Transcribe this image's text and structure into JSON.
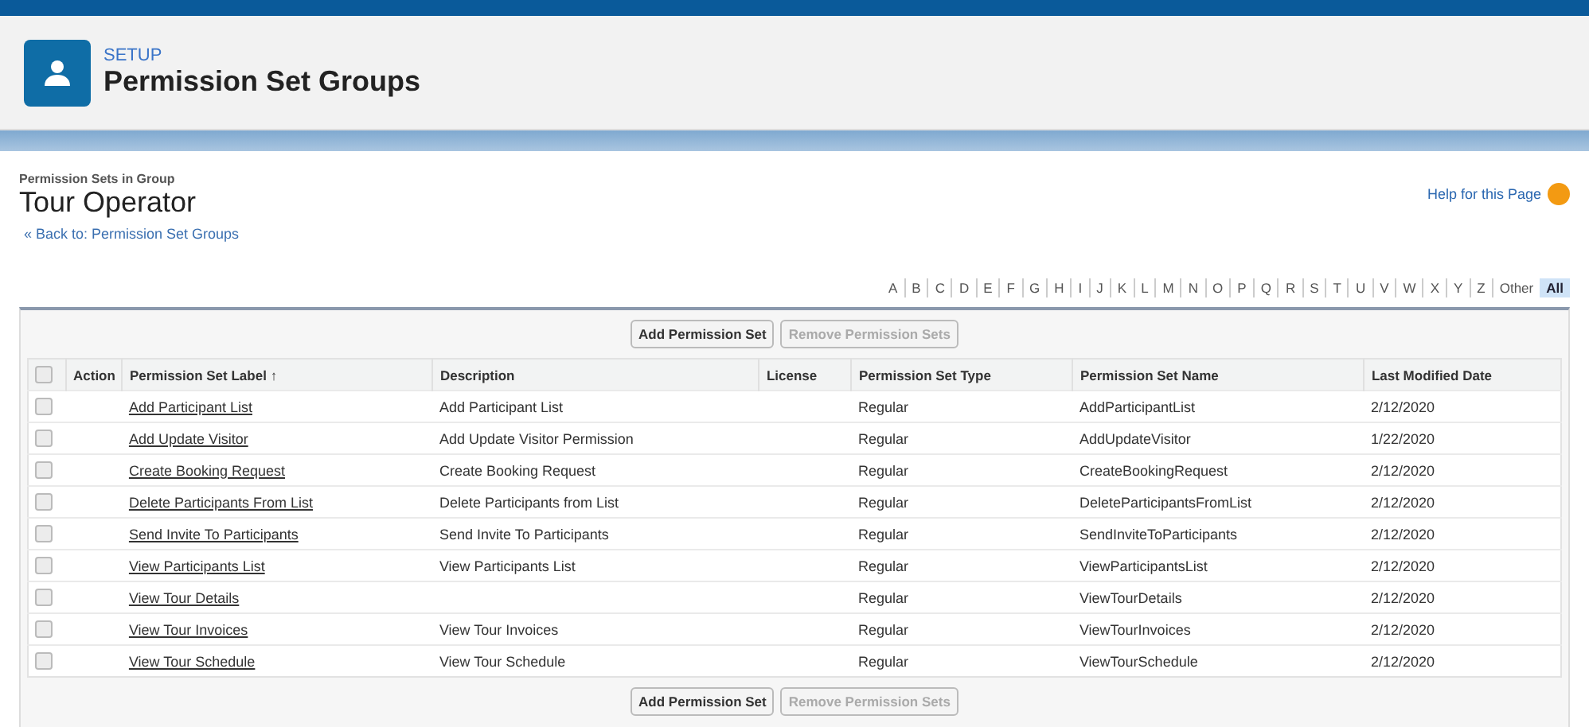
{
  "header": {
    "eyebrow": "SETUP",
    "title": "Permission Set Groups"
  },
  "page": {
    "subtitle": "Permission Sets in Group",
    "title": "Tour Operator",
    "back_link": "« Back to: Permission Set Groups",
    "help_link": "Help for this Page"
  },
  "letters": [
    {
      "label": "A",
      "selected": false
    },
    {
      "label": "B",
      "selected": false
    },
    {
      "label": "C",
      "selected": false
    },
    {
      "label": "D",
      "selected": false
    },
    {
      "label": "E",
      "selected": false
    },
    {
      "label": "F",
      "selected": false
    },
    {
      "label": "G",
      "selected": false
    },
    {
      "label": "H",
      "selected": false
    },
    {
      "label": "I",
      "selected": false
    },
    {
      "label": "J",
      "selected": false
    },
    {
      "label": "K",
      "selected": false
    },
    {
      "label": "L",
      "selected": false
    },
    {
      "label": "M",
      "selected": false
    },
    {
      "label": "N",
      "selected": false
    },
    {
      "label": "O",
      "selected": false
    },
    {
      "label": "P",
      "selected": false
    },
    {
      "label": "Q",
      "selected": false
    },
    {
      "label": "R",
      "selected": false
    },
    {
      "label": "S",
      "selected": false
    },
    {
      "label": "T",
      "selected": false
    },
    {
      "label": "U",
      "selected": false
    },
    {
      "label": "V",
      "selected": false
    },
    {
      "label": "W",
      "selected": false
    },
    {
      "label": "X",
      "selected": false
    },
    {
      "label": "Y",
      "selected": false
    },
    {
      "label": "Z",
      "selected": false
    },
    {
      "label": "Other",
      "selected": false
    },
    {
      "label": "All",
      "selected": true
    }
  ],
  "top_buttons": [
    {
      "label": "Add Permission Set",
      "disabled": false
    },
    {
      "label": "Remove Permission Sets",
      "disabled": true
    }
  ],
  "bottom_buttons": [
    {
      "label": "Add Permission Set",
      "disabled": false
    },
    {
      "label": "Remove Permission Sets",
      "disabled": true
    }
  ],
  "table": {
    "select_all_checked": false,
    "sort_indicator": "↑",
    "columns": [
      "Action",
      "Permission Set Label",
      "Description",
      "License",
      "Permission Set Type",
      "Permission Set Name",
      "Last Modified Date"
    ],
    "rows": [
      {
        "checked": false,
        "label": "Add Participant List",
        "description": "Add Participant List",
        "type": "Regular",
        "name": "AddParticipantList",
        "date": "2/12/2020"
      },
      {
        "checked": false,
        "label": "Add Update Visitor",
        "description": "Add Update Visitor Permission",
        "type": "Regular",
        "name": "AddUpdateVisitor",
        "date": "1/22/2020"
      },
      {
        "checked": false,
        "label": "Create Booking Request",
        "description": "Create Booking Request",
        "type": "Regular",
        "name": "CreateBookingRequest",
        "date": "2/12/2020"
      },
      {
        "checked": false,
        "label": "Delete Participants From List",
        "description": "Delete Participants from List",
        "type": "Regular",
        "name": "DeleteParticipantsFromList",
        "date": "2/12/2020"
      },
      {
        "checked": false,
        "label": "Send Invite To Participants",
        "description": "Send Invite To Participants",
        "type": "Regular",
        "name": "SendInviteToParticipants",
        "date": "2/12/2020"
      },
      {
        "checked": false,
        "label": "View Participants List",
        "description": "View Participants List",
        "type": "Regular",
        "name": "ViewParticipantsList",
        "date": "2/12/2020"
      },
      {
        "checked": false,
        "label": "View Tour Details",
        "type": "Regular",
        "name": "ViewTourDetails",
        "date": "2/12/2020"
      },
      {
        "checked": false,
        "label": "View Tour Invoices",
        "description": "View Tour Invoices",
        "type": "Regular",
        "name": "ViewTourInvoices",
        "date": "2/12/2020"
      },
      {
        "checked": false,
        "label": "View Tour Schedule",
        "description": "View Tour Schedule",
        "type": "Regular",
        "name": "ViewTourSchedule",
        "date": "2/12/2020"
      }
    ]
  }
}
